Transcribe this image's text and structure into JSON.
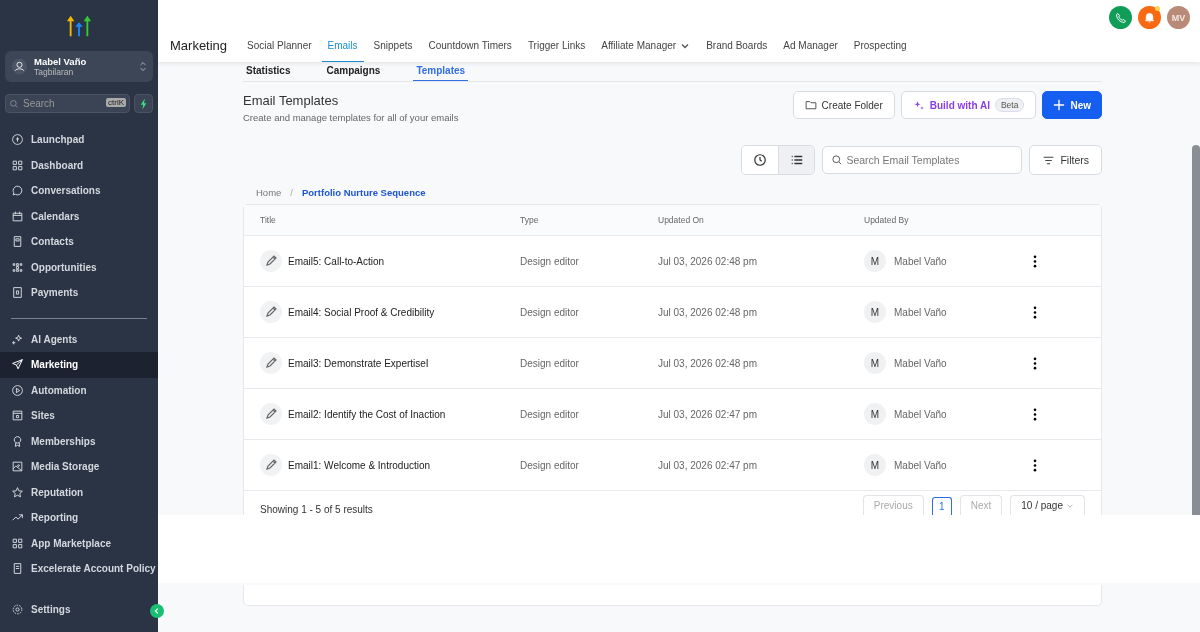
{
  "sidebar": {
    "account": {
      "name": "Mabel Vaño",
      "location": "Tagbilaran"
    },
    "search": {
      "placeholder": "Search",
      "shortcut": "ctrlK"
    },
    "items": [
      {
        "label": "Launchpad",
        "selected": false
      },
      {
        "label": "Dashboard",
        "selected": false
      },
      {
        "label": "Conversations",
        "selected": false
      },
      {
        "label": "Calendars",
        "selected": false
      },
      {
        "label": "Contacts",
        "selected": false
      },
      {
        "label": "Opportunities",
        "selected": false
      },
      {
        "label": "Payments",
        "selected": false
      }
    ],
    "items2": [
      {
        "label": "AI Agents",
        "selected": false
      },
      {
        "label": "Marketing",
        "selected": true
      },
      {
        "label": "Automation",
        "selected": false
      },
      {
        "label": "Sites",
        "selected": false
      },
      {
        "label": "Memberships",
        "selected": false
      },
      {
        "label": "Media Storage",
        "selected": false
      },
      {
        "label": "Reputation",
        "selected": false
      },
      {
        "label": "Reporting",
        "selected": false
      },
      {
        "label": "App Marketplace",
        "selected": false
      },
      {
        "label": "Excelerate Account Policy",
        "selected": false
      }
    ],
    "settings": "Settings"
  },
  "header": {
    "title": "Marketing",
    "tabs": [
      {
        "label": "Social Planner",
        "selected": false
      },
      {
        "label": "Emails",
        "selected": true
      },
      {
        "label": "Snippets",
        "selected": false
      },
      {
        "label": "Countdown Timers",
        "selected": false
      },
      {
        "label": "Trigger Links",
        "selected": false
      },
      {
        "label": "Affiliate Manager",
        "selected": false,
        "dropdown": true
      },
      {
        "label": "Brand Boards",
        "selected": false
      },
      {
        "label": "Ad Manager",
        "selected": false
      },
      {
        "label": "Prospecting",
        "selected": false
      }
    ],
    "avatar": "MV"
  },
  "subtabs": [
    {
      "label": "Statistics",
      "selected": false
    },
    {
      "label": "Campaigns",
      "selected": false
    },
    {
      "label": "Templates",
      "selected": true
    }
  ],
  "page": {
    "title": "Email Templates",
    "subtitle": "Create and manage templates for all of your emails",
    "buttons": {
      "folder": "Create Folder",
      "ai": "Build with AI",
      "beta": "Beta",
      "new": "New"
    },
    "views": [
      {
        "kind": "recent",
        "selected": false
      },
      {
        "kind": "list",
        "selected": true
      }
    ],
    "search_placeholder": "Search Email Templates",
    "filters": "Filters",
    "breadcrumb": {
      "items": [
        "Home",
        "Portfolio Nurture Sequence"
      ],
      "separator": "/"
    }
  },
  "table": {
    "columns": [
      "Title",
      "Type",
      "Updated On",
      "Updated By"
    ],
    "rows": [
      {
        "title": "Email5: Call-to-Action",
        "type": "Design editor",
        "updated_on": "Jul 03, 2026 02:48 pm",
        "initial": "M",
        "updated_by": "Mabel Vaño"
      },
      {
        "title": "Email4: Social Proof & Credibility",
        "type": "Design editor",
        "updated_on": "Jul 03, 2026 02:48 pm",
        "initial": "M",
        "updated_by": "Mabel Vaño"
      },
      {
        "title": "Email3: Demonstrate ExpertiseI",
        "type": "Design editor",
        "updated_on": "Jul 03, 2026 02:48 pm",
        "initial": "M",
        "updated_by": "Mabel Vaño"
      },
      {
        "title": "Email2: Identify the Cost of Inaction",
        "type": "Design editor",
        "updated_on": "Jul 03, 2026 02:47 pm",
        "initial": "M",
        "updated_by": "Mabel Vaño"
      },
      {
        "title": "Email1: Welcome & Introduction",
        "type": "Design editor",
        "updated_on": "Jul 03, 2026 02:47 pm",
        "initial": "M",
        "updated_by": "Mabel Vaño"
      }
    ],
    "summary": "Showing 1 - 5 of 5 results",
    "pagination": {
      "previous": "Previous",
      "pages": [
        {
          "label": "1",
          "selected": true
        }
      ],
      "next": "Next",
      "per_page": "10 / page"
    }
  }
}
